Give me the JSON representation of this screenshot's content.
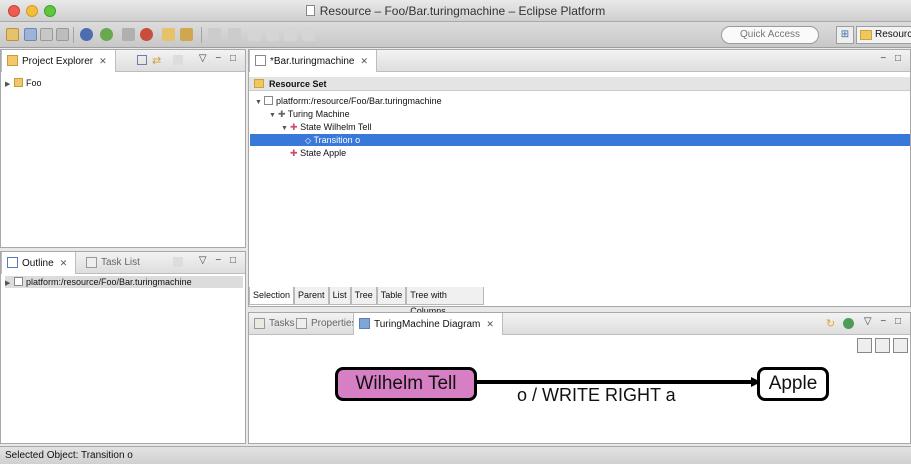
{
  "window": {
    "title": "Resource – Foo/Bar.turingmachine – Eclipse Platform"
  },
  "toolbar": {
    "quick_access": "Quick Access",
    "perspective": "Resource"
  },
  "project_explorer": {
    "tab": "Project Explorer",
    "tab_close": "✕",
    "controls": "▽ − □",
    "items": [
      {
        "label": "Foo"
      }
    ]
  },
  "outline": {
    "tab": "Outline",
    "tab_close": "✕",
    "task_list_tab": "Task List",
    "controls": "▽ − □",
    "items": [
      {
        "label": "platform:/resource/Foo/Bar.turingmachine"
      }
    ]
  },
  "editor": {
    "tab": "*Bar.turingmachine",
    "tab_close": "✕",
    "controls": "− □",
    "resource_set": "Resource Set",
    "tree": [
      {
        "label": "platform:/resource/Foo/Bar.turingmachine",
        "depth": 0,
        "expanded": true
      },
      {
        "label": "Turing Machine",
        "depth": 1,
        "expanded": true
      },
      {
        "label": "State Wilhelm Tell",
        "depth": 2,
        "expanded": true
      },
      {
        "label": "Transition o",
        "depth": 3,
        "selected": true
      },
      {
        "label": "State Apple",
        "depth": 2
      }
    ],
    "bottom_tabs": [
      "Selection",
      "Parent",
      "List",
      "Tree",
      "Table",
      "Tree with Columns"
    ]
  },
  "bottom_panel": {
    "tabs": [
      {
        "label": "Tasks"
      },
      {
        "label": "Properties"
      },
      {
        "label": "TuringMachine Diagram",
        "active": true,
        "close": "✕"
      }
    ],
    "controls": "▽ − □"
  },
  "diagram": {
    "nodes": [
      {
        "label": "Wilhelm Tell",
        "fill": "#d77fc4"
      },
      {
        "label": "Apple",
        "fill": "#ffffff"
      }
    ],
    "edge_label": "o / WRITE RIGHT a"
  },
  "status": {
    "text": "Selected Object: Transition o"
  },
  "colors": {
    "selection": "#3778d9",
    "node_fill": "#d77fc4"
  }
}
